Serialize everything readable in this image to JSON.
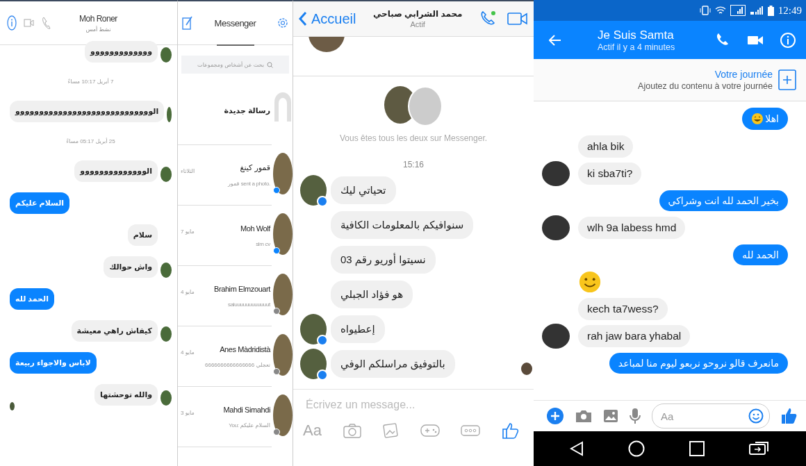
{
  "left_chat": {
    "title": "Moh Roner",
    "subtitle": "نشط أمس",
    "messages": [
      {
        "kind": "incoming",
        "text": "ووووووووووووو",
        "avatar": true
      },
      {
        "kind": "timestamp",
        "text": "7 أبريل 10:17 مساءً"
      },
      {
        "kind": "incoming",
        "text": "الووووووووووووووووووووووووووووو",
        "avatar": true
      },
      {
        "kind": "timestamp",
        "text": "25 أبريل 05:17 مساءً"
      },
      {
        "kind": "incoming",
        "text": "الوووووووووووووو",
        "avatar": true
      },
      {
        "kind": "outgoing",
        "text": "السلام عليكم"
      },
      {
        "kind": "incoming",
        "text": "سلام",
        "avatar": false
      },
      {
        "kind": "incoming",
        "text": "واش حوالك",
        "avatar": true
      },
      {
        "kind": "outgoing",
        "text": "الحمد لله"
      },
      {
        "kind": "incoming",
        "text": "كيفاش راهي معيشة",
        "avatar": true
      },
      {
        "kind": "outgoing",
        "text": "لاباس والاجواء ربيعة"
      },
      {
        "kind": "incoming",
        "text": "والله توحشتها",
        "avatar": true
      }
    ]
  },
  "conversation_list": {
    "title": "Messenger",
    "search": {
      "placeholder": "بحث عن أشخاص ومجموعات"
    },
    "items": [
      {
        "kind": "new",
        "name": "رسالة جديدة"
      },
      {
        "kind": "messenger",
        "name": "قمور كينغ",
        "preview": "قمور sent a photo.",
        "time": "الثلاثاء"
      },
      {
        "kind": "messenger",
        "name": "Moh Wolf",
        "preview": "slm cv",
        "time": "7 مايو"
      },
      {
        "kind": "facebook",
        "name": "Brahim Elmzouart",
        "preview": "saluuuuuuuuuuuut",
        "time": "4 مايو"
      },
      {
        "kind": "facebook",
        "name": "Anes Màdridistà",
        "preview": "تعجلي 6666666666666666",
        "time": "4 مايو"
      },
      {
        "kind": "facebook",
        "name": "Mahdi Simahdi",
        "preview": "You: السلام عليكم",
        "time": "3 مايو"
      }
    ]
  },
  "middle_chat": {
    "back": "Accueil",
    "name": "محمد الشرابي صباحي",
    "status": "Actif",
    "intro": "Vous êtes tous les deux sur Messenger.",
    "time": "15:16",
    "messages": [
      {
        "text": "تحياتي ليك",
        "avatar": true
      },
      {
        "text": "سنوافيكم بالمعلومات الكافية",
        "avatar": false
      },
      {
        "text": "نسيتوا أوريو رقم 03",
        "avatar": false
      },
      {
        "text": "هو فؤاد الجبلي",
        "avatar": false
      },
      {
        "text": "إعطيواه",
        "avatar": true
      },
      {
        "text": "بالتوفيق مراسلكم الوفي",
        "avatar": true
      }
    ],
    "composer": {
      "placeholder": "Écrivez un message...",
      "format_label": "Aa"
    }
  },
  "right_chat": {
    "clock": "12:49",
    "name": "Je Suis Samta",
    "status": "Actif il y a 4 minutes",
    "story": {
      "title": "Votre journée",
      "subtitle": "Ajoutez du contenu à votre journée"
    },
    "messages": [
      {
        "kind": "outgoing",
        "text": "اهلا",
        "emoji": true
      },
      {
        "kind": "incoming",
        "text": "ahla bik",
        "avatar": false
      },
      {
        "kind": "incoming",
        "text": "ki sba7ti?",
        "avatar": true
      },
      {
        "kind": "outgoing",
        "text": "بخير الحمد لله انت وشراكي",
        "emoji": false
      },
      {
        "kind": "incoming",
        "text": "wlh 9a labess hmd",
        "avatar": true
      },
      {
        "kind": "outgoing",
        "text": "الحمد لله",
        "emoji": false
      },
      {
        "kind": "emoji",
        "avatar": false
      },
      {
        "kind": "incoming",
        "text": "kech ta7wess?",
        "avatar": false
      },
      {
        "kind": "incoming",
        "text": "rah jaw bara yhabal",
        "avatar": true
      },
      {
        "kind": "outgoing",
        "text": "مانعرف قالو نروحو نربعو ليوم منا لمباعد",
        "emoji": false
      }
    ],
    "composer": {
      "placeholder": "Aa"
    }
  }
}
